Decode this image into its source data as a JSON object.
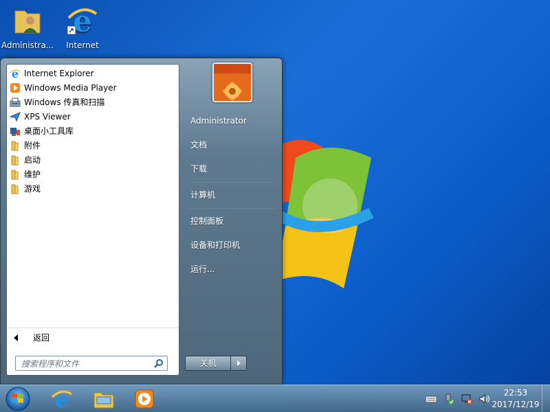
{
  "desktop": {
    "icons": [
      {
        "label": "Administra..."
      },
      {
        "label": "Internet\nExplorer"
      }
    ]
  },
  "start_menu": {
    "programs": [
      {
        "label": "Internet Explorer",
        "icon": "ie-icon"
      },
      {
        "label": "Windows Media Player",
        "icon": "media-player-icon"
      },
      {
        "label": "Windows 传真和扫描",
        "icon": "fax-scan-icon"
      },
      {
        "label": "XPS Viewer",
        "icon": "xps-viewer-icon"
      },
      {
        "label": "桌面小工具库",
        "icon": "gadgets-icon"
      },
      {
        "label": "附件",
        "icon": "folder-icon"
      },
      {
        "label": "启动",
        "icon": "folder-icon"
      },
      {
        "label": "维护",
        "icon": "folder-icon"
      },
      {
        "label": "游戏",
        "icon": "folder-icon"
      }
    ],
    "back_label": "返回",
    "search_placeholder": "搜索程序和文件",
    "right_items": [
      {
        "label": "Administrator"
      },
      {
        "label": "文档"
      },
      {
        "label": "下载"
      },
      {
        "label": "计算机"
      },
      {
        "label": "控制面板"
      },
      {
        "label": "设备和打印机"
      },
      {
        "label": "运行..."
      }
    ],
    "shutdown_label": "关机"
  },
  "taskbar": {
    "time": "22:53",
    "date": "2017/12/19",
    "pinned": [
      "ie-icon",
      "explorer-folder-icon",
      "media-player-icon"
    ]
  },
  "colors": {
    "desktop": "#0b5cc7",
    "menu_right": "#5f7a90",
    "accent_orange": "#f28a1e"
  }
}
